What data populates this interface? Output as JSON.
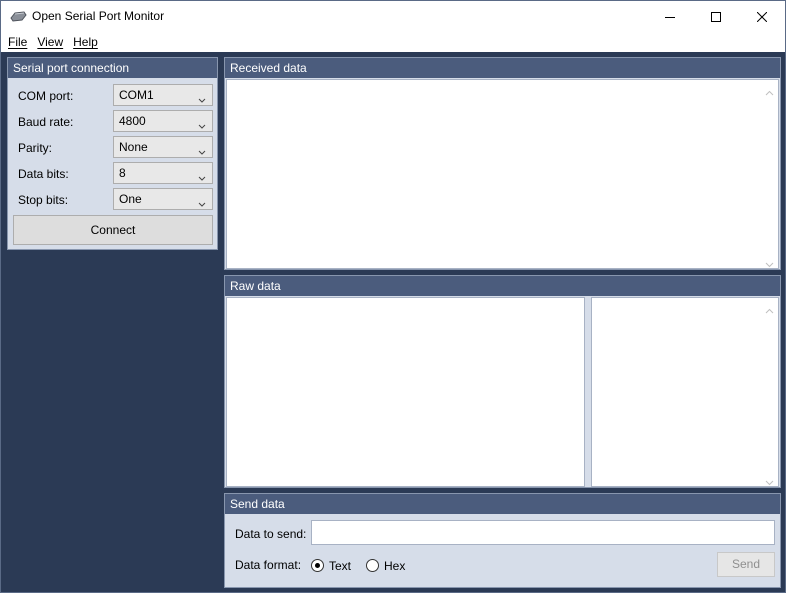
{
  "window": {
    "title": "Open Serial Port Monitor"
  },
  "menu": {
    "items": [
      {
        "label": "File"
      },
      {
        "label": "View"
      },
      {
        "label": "Help"
      }
    ]
  },
  "connection": {
    "header": "Serial port connection",
    "fields": [
      {
        "label": "COM port:",
        "value": "COM1"
      },
      {
        "label": "Baud rate:",
        "value": "4800"
      },
      {
        "label": "Parity:",
        "value": "None"
      },
      {
        "label": "Data bits:",
        "value": "8"
      },
      {
        "label": "Stop bits:",
        "value": "One"
      }
    ],
    "connect_label": "Connect"
  },
  "received": {
    "header": "Received data"
  },
  "raw": {
    "header": "Raw data"
  },
  "send": {
    "header": "Send data",
    "data_label": "Data to send:",
    "data_value": "",
    "format_label": "Data format:",
    "format_options": [
      {
        "label": "Text",
        "selected": true
      },
      {
        "label": "Hex",
        "selected": false
      }
    ],
    "send_label": "Send"
  },
  "icons": {
    "app": "serial-cable-icon",
    "minimize": "minimize-icon",
    "maximize": "maximize-icon",
    "close": "close-icon",
    "dropdown": "chevron-down-icon",
    "scroll_up": "scroll-up-icon",
    "scroll_down": "scroll-down-icon"
  },
  "colors": {
    "background": "#2b3a55",
    "panel_header": "#4b5c7d",
    "panel_body": "#d6dde9"
  }
}
